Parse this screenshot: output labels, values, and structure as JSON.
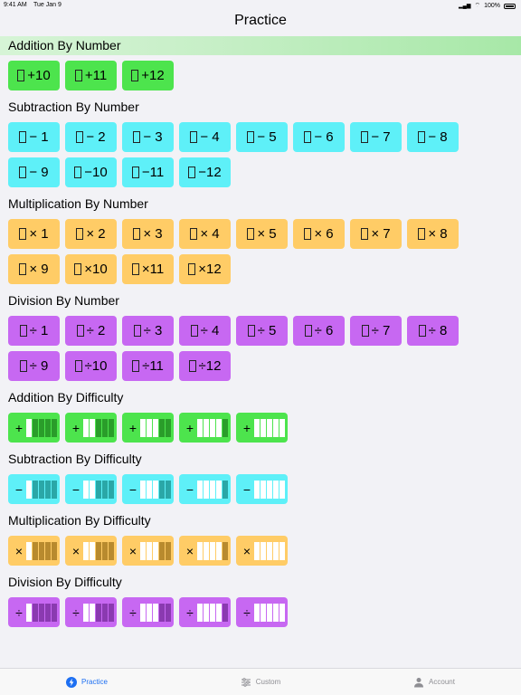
{
  "status": {
    "time": "9:41 AM",
    "date": "Tue Jan 9",
    "battery": "100%"
  },
  "nav": {
    "title": "Practice"
  },
  "sections": [
    {
      "title": "Addition By Number",
      "type": "number",
      "color": "green",
      "highlight": true,
      "items": [
        "+10",
        "+11",
        "+12"
      ]
    },
    {
      "title": "Subtraction By Number",
      "type": "number",
      "color": "cyan",
      "items": [
        "− 1",
        "− 2",
        "− 3",
        "− 4",
        "− 5",
        "− 6",
        "− 7",
        "− 8",
        "− 9",
        "−10",
        "−11",
        "−12"
      ]
    },
    {
      "title": "Multiplication By Number",
      "type": "number",
      "color": "orange",
      "items": [
        "× 1",
        "× 2",
        "× 3",
        "× 4",
        "× 5",
        "× 6",
        "× 7",
        "× 8",
        "× 9",
        "×10",
        "×11",
        "×12"
      ]
    },
    {
      "title": "Division By Number",
      "type": "number",
      "color": "purple",
      "items": [
        "÷ 1",
        "÷ 2",
        "÷ 3",
        "÷ 4",
        "÷ 5",
        "÷ 6",
        "÷ 7",
        "÷ 8",
        "÷ 9",
        "÷10",
        "÷11",
        "÷12"
      ]
    },
    {
      "title": "Addition By Difficulty",
      "type": "difficulty",
      "color": "green",
      "symbol": "+",
      "dark": "#2a9d2a",
      "light": "#ffffff",
      "levels": [
        1,
        2,
        3,
        4,
        5
      ]
    },
    {
      "title": "Subtraction By Difficulty",
      "type": "difficulty",
      "color": "cyan",
      "symbol": "−",
      "dark": "#2aa7a7",
      "light": "#ffffff",
      "levels": [
        1,
        2,
        3,
        4,
        5
      ]
    },
    {
      "title": "Multiplication By Difficulty",
      "type": "difficulty",
      "color": "orange",
      "symbol": "×",
      "dark": "#b88a2e",
      "light": "#ffffff",
      "levels": [
        1,
        2,
        3,
        4,
        5
      ]
    },
    {
      "title": "Division By Difficulty",
      "type": "difficulty",
      "color": "purple",
      "symbol": "÷",
      "dark": "#8a3ab0",
      "light": "#ffffff",
      "levels": [
        1,
        2,
        3,
        4,
        5
      ]
    }
  ],
  "tabs": [
    {
      "label": "Practice",
      "icon": "bolt-icon",
      "active": true
    },
    {
      "label": "Custom",
      "icon": "sliders-icon",
      "active": false
    },
    {
      "label": "Account",
      "icon": "person-icon",
      "active": false
    }
  ],
  "colors": {
    "accent": "#1d6ff2",
    "green": "#4de44d",
    "cyan": "#5ef0f8",
    "orange": "#ffcc66",
    "purple": "#c768f2"
  }
}
